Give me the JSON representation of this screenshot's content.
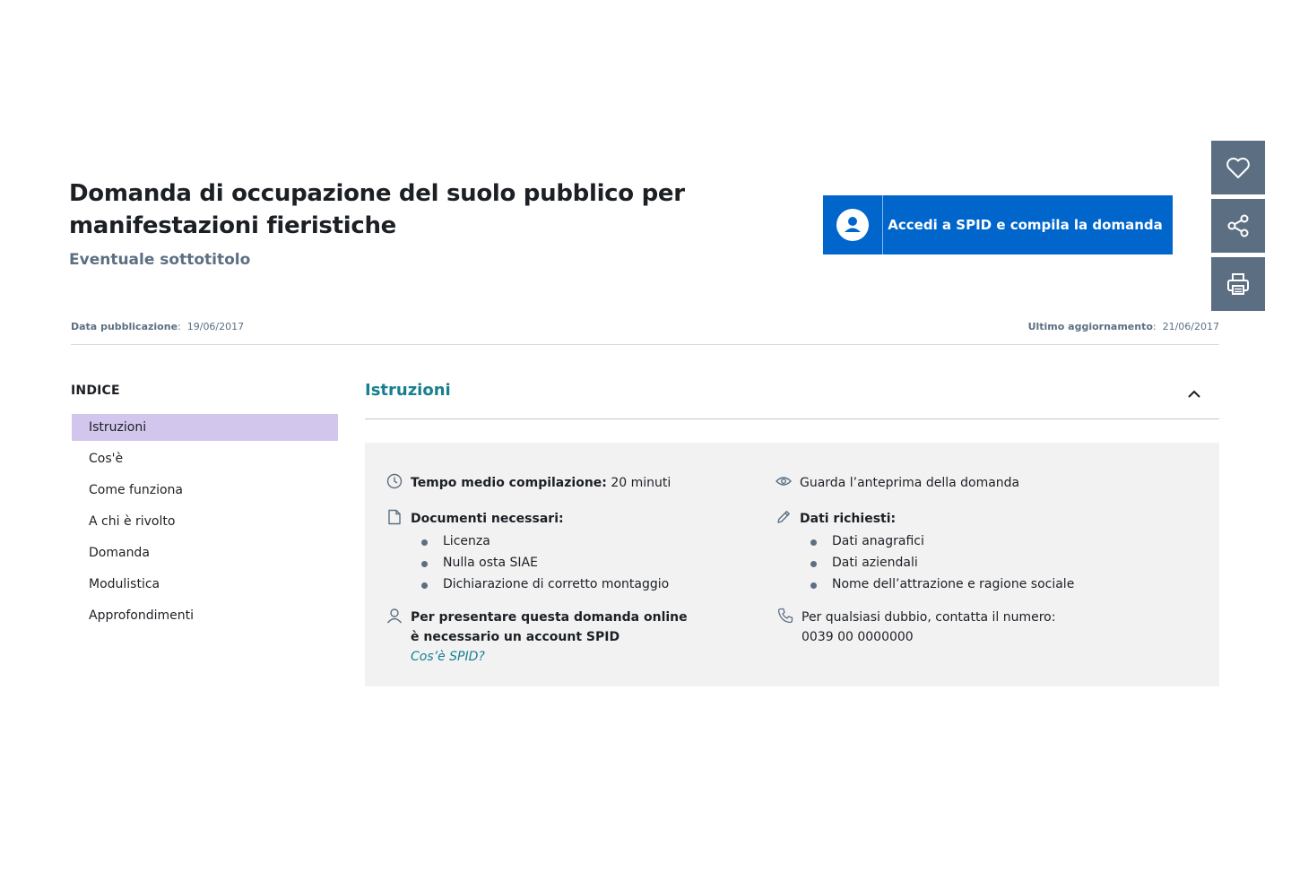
{
  "header": {
    "title": "Domanda di occupazione del suolo pubblico per manifestazioni fieristiche",
    "subtitle": "Eventuale sottotitolo"
  },
  "cta": {
    "label": "Accedi a SPID e compila la domanda",
    "icon": "user-icon",
    "color": "#0066cc"
  },
  "side_actions": [
    {
      "icon": "heart-icon"
    },
    {
      "icon": "share-icon"
    },
    {
      "icon": "print-icon"
    }
  ],
  "meta": {
    "published_label": "Data pubblicazione",
    "published_value": "19/06/2017",
    "updated_label": "Ultimo aggiornamento",
    "updated_value": "21/06/2017"
  },
  "index": {
    "title": "INDICE",
    "items": [
      {
        "label": "Istruzioni",
        "active": true
      },
      {
        "label": "Cos'è"
      },
      {
        "label": "Come funziona"
      },
      {
        "label": "A chi è rivolto"
      },
      {
        "label": "Domanda"
      },
      {
        "label": "Modulistica"
      },
      {
        "label": "Approfondimenti"
      }
    ]
  },
  "section": {
    "title": "Istruzioni"
  },
  "info": {
    "time_label": "Tempo medio compilazione:",
    "time_value": "20 minuti",
    "preview_label": "Guarda l’anteprima della domanda",
    "docs_label": "Documenti necessari:",
    "docs": [
      "Licenza",
      "Nulla osta SIAE",
      "Dichiarazione di corretto montaggio"
    ],
    "data_label": "Dati richiesti:",
    "data": [
      "Dati anagrafici",
      "Dati aziendali",
      "Nome dell’attrazione e ragione sociale"
    ],
    "spid_line1": "Per presentare questa domanda online",
    "spid_line2": "è necessario un account SPID",
    "spid_link": "Cos’è SPID?",
    "contact_line1": "Per qualsiasi dubbio, contatta il numero:",
    "contact_number": "0039 00 0000000"
  }
}
